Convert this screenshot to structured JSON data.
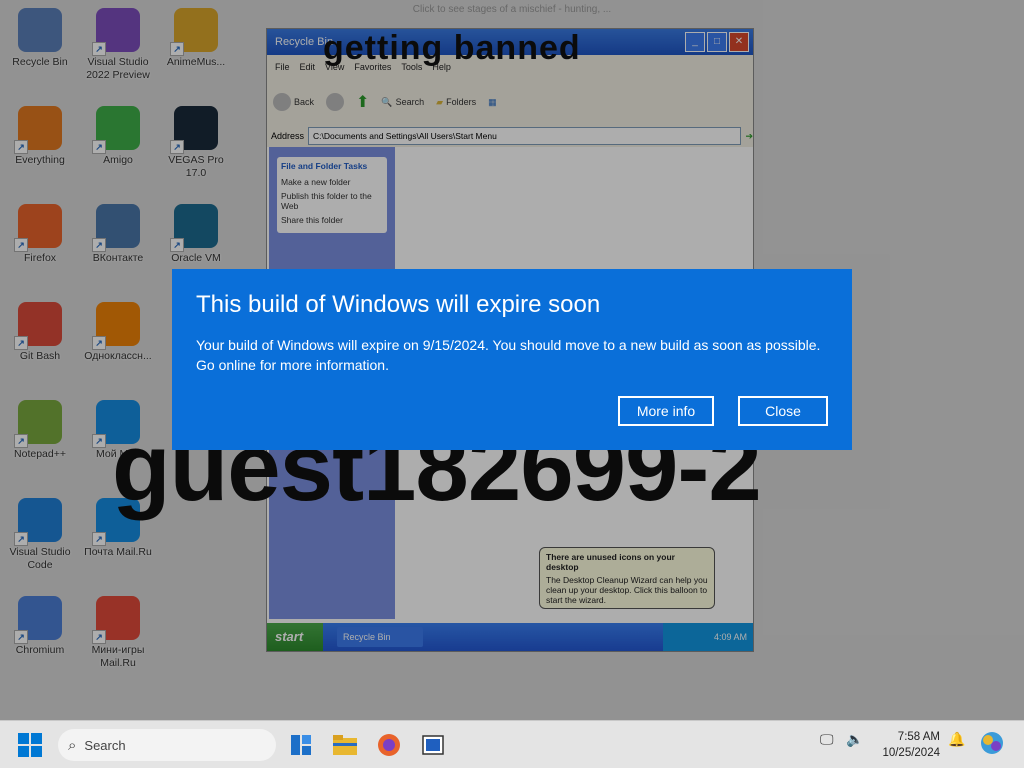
{
  "wallpaper": {
    "top_text": "Click to see stages of a mischief - hunting, ...",
    "watermark": "guest182699-2"
  },
  "desktop_icons": [
    {
      "label": "Recycle Bin",
      "icon": "recycle-bin-icon",
      "color": "#5a7fb8"
    },
    {
      "label": "Visual Studio 2022 Preview",
      "icon": "visual-studio-icon",
      "color": "#7c4dbc"
    },
    {
      "label": "AnimeMus...",
      "icon": "music-icon",
      "color": "#d9a52b"
    },
    {
      "label": "Everything",
      "icon": "magnifier-icon",
      "color": "#e07820"
    },
    {
      "label": "Amigo",
      "icon": "amigo-icon",
      "color": "#3fae49"
    },
    {
      "label": "VEGAS Pro 17.0",
      "icon": "vegas-icon",
      "color": "#1a2a3a"
    },
    {
      "label": "Firefox",
      "icon": "firefox-icon",
      "color": "#e8632b"
    },
    {
      "label": "ВКонтакте",
      "icon": "vk-icon",
      "color": "#4a76a8"
    },
    {
      "label": "Oracle VM",
      "icon": "virtualbox-icon",
      "color": "#1d6b8f"
    },
    {
      "label": "Git Bash",
      "icon": "git-icon",
      "color": "#d94a3a"
    },
    {
      "label": "Одноклассн...",
      "icon": "ok-icon",
      "color": "#ee8208"
    },
    {
      "label": "Notepad++",
      "icon": "notepad-icon",
      "color": "#7aa83f"
    },
    {
      "label": "Мой Мир",
      "icon": "moymir-icon",
      "color": "#168de2"
    },
    {
      "label": "Visual Studio Code",
      "icon": "vscode-icon",
      "color": "#1f7fd6"
    },
    {
      "label": "Почта Mail.Ru",
      "icon": "mail-icon",
      "color": "#168de2"
    },
    {
      "label": "Chromium",
      "icon": "chromium-icon",
      "color": "#4c7ed4"
    },
    {
      "label": "Мини-игры Mail.Ru",
      "icon": "games-icon",
      "color": "#e04a3a"
    }
  ],
  "xp_window": {
    "title": "Recycle Bin",
    "overlay_text": "getting banned",
    "menu": [
      "File",
      "Edit",
      "View",
      "Favorites",
      "Tools",
      "Help"
    ],
    "toolbar": [
      "Back",
      "Search",
      "Folders"
    ],
    "address_label": "Address",
    "address": "C:\\Documents and Settings\\All Users\\Start Menu",
    "side_panel_title": "File and Folder Tasks",
    "side_panel_items": [
      "Make a new folder",
      "Publish this folder to the Web",
      "Share this folder"
    ],
    "balloon_title": "There are unused icons on your desktop",
    "balloon_text": "The Desktop Cleanup Wizard can help you clean up your desktop. Click this balloon to start the wizard.",
    "start_label": "start",
    "task_label": "Recycle Bin",
    "tray_time": "4:09 AM"
  },
  "dialog": {
    "title": "This build of Windows will expire soon",
    "message": "Your build of Windows will expire on 9/15/2024. You should move to a new build as soon as possible. Go online for more information.",
    "more_info": "More info",
    "close": "Close",
    "bg_color": "#0a6fd9"
  },
  "taskbar": {
    "search_placeholder": "Search",
    "time": "7:58 AM",
    "date": "10/25/2024"
  }
}
